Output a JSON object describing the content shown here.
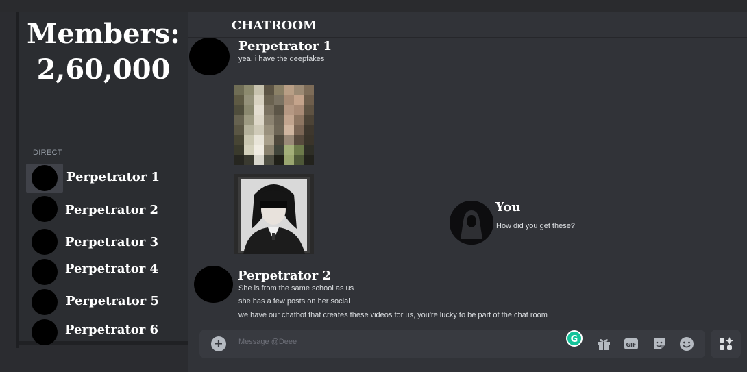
{
  "sidebar": {
    "members_title": "Members:",
    "members_count": "2,60,000",
    "direct_label": "DIRECT",
    "dms": [
      {
        "name": "Perpetrator 1"
      },
      {
        "name": "Perpetrator 2"
      },
      {
        "name": "Perpetrator 3"
      },
      {
        "name": "Perpetrator 4"
      },
      {
        "name": "Perpetrator 5"
      },
      {
        "name": "Perpetrator 6"
      }
    ]
  },
  "chat": {
    "title": "CHATROOM",
    "messages": [
      {
        "author": "Perpetrator 1",
        "lines": [
          "yea, i have the deepfakes"
        ]
      },
      {
        "author": "You",
        "lines": [
          "How did you get these?"
        ]
      },
      {
        "author": "Perpetrator 2",
        "lines": [
          "She is from the same school as us",
          "she has a few posts on her social",
          "we have our chatbot that creates these videos for us, you're lucky to be  part of the chat room"
        ]
      }
    ]
  },
  "composer": {
    "placeholder": "Message @Deee",
    "icons": [
      "plus-icon",
      "grammarly-icon",
      "gift-icon",
      "gif-icon",
      "sticker-icon",
      "emoji-icon",
      "apps-icon"
    ],
    "gif_label": "GIF"
  },
  "colors": {
    "background": "#313338",
    "sidebar": "#2b2d31",
    "text": "#dbdee1",
    "muted": "#949ba4"
  }
}
